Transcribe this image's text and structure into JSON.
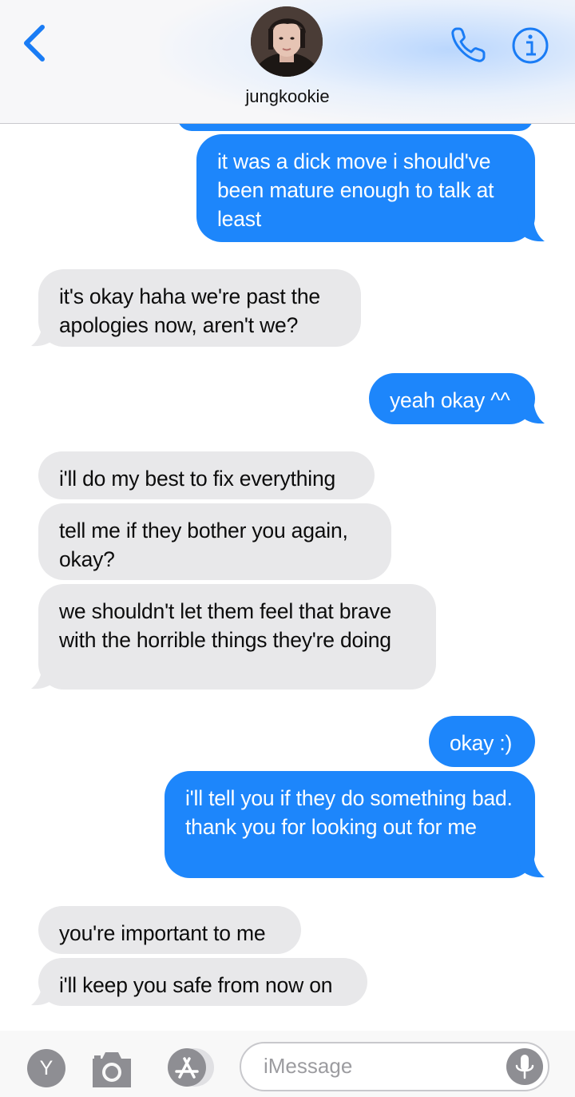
{
  "header": {
    "contact_name": "jungkookie"
  },
  "messages": [
    {
      "id": "m0",
      "direction": "outgoing",
      "text": "it was a dick move i should've been mature enough to talk at least"
    },
    {
      "id": "m1",
      "direction": "incoming",
      "text": "it's okay haha we're past the apologies now, aren't we?"
    },
    {
      "id": "m2",
      "direction": "outgoing",
      "text": "yeah okay ^^"
    },
    {
      "id": "m3",
      "direction": "incoming",
      "text": "i'll do my best to fix everything"
    },
    {
      "id": "m4",
      "direction": "incoming",
      "text": "tell me if they bother you again, okay?"
    },
    {
      "id": "m5",
      "direction": "incoming",
      "text": "we shouldn't let them feel that brave with the horrible things they're doing"
    },
    {
      "id": "m6",
      "direction": "outgoing",
      "text": "okay :)"
    },
    {
      "id": "m7",
      "direction": "outgoing",
      "text": "i'll tell you if they do something bad. thank you for looking out for me"
    },
    {
      "id": "m8",
      "direction": "incoming",
      "text": "you're important to me"
    },
    {
      "id": "m9",
      "direction": "incoming",
      "text": "i'll keep you safe from now on"
    }
  ],
  "composer": {
    "app_button_letter": "Y",
    "placeholder": "iMessage"
  },
  "icons": {
    "back": "chevron-left-icon",
    "call": "phone-icon",
    "info": "info-icon",
    "camera": "camera-icon",
    "apps": "app-store-icon",
    "mic": "microphone-icon"
  },
  "colors": {
    "outgoing_bubble": "#1d86fb",
    "incoming_bubble": "#e8e8ea",
    "accent": "#1a7cf5"
  }
}
